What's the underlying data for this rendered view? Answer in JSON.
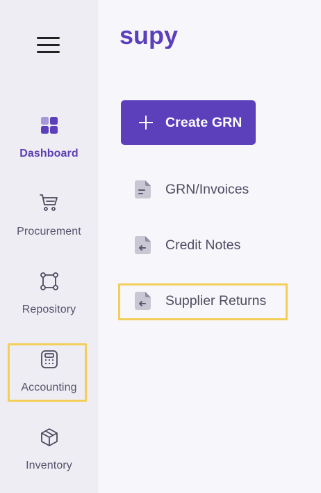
{
  "app": {
    "logo_text": "supy",
    "brand_color": "#5b3fbb",
    "highlight_color": "#f3cf5a"
  },
  "sidebar": {
    "menu_icon": "hamburger-icon",
    "items": [
      {
        "label": "Dashboard",
        "icon": "dashboard-icon",
        "active": true
      },
      {
        "label": "Procurement",
        "icon": "cart-icon",
        "active": false
      },
      {
        "label": "Repository",
        "icon": "repository-icon",
        "active": false
      },
      {
        "label": "Accounting",
        "icon": "calculator-icon",
        "active": false,
        "highlighted": true
      },
      {
        "label": "Inventory",
        "icon": "box-icon",
        "active": false
      }
    ]
  },
  "main": {
    "create_button": {
      "label": "Create GRN",
      "icon": "plus-icon"
    },
    "menu": [
      {
        "label": "GRN/Invoices",
        "icon": "document-icon"
      },
      {
        "label": "Credit Notes",
        "icon": "document-return-icon"
      },
      {
        "label": "Supplier Returns",
        "icon": "document-return-icon",
        "highlighted": true
      }
    ]
  }
}
